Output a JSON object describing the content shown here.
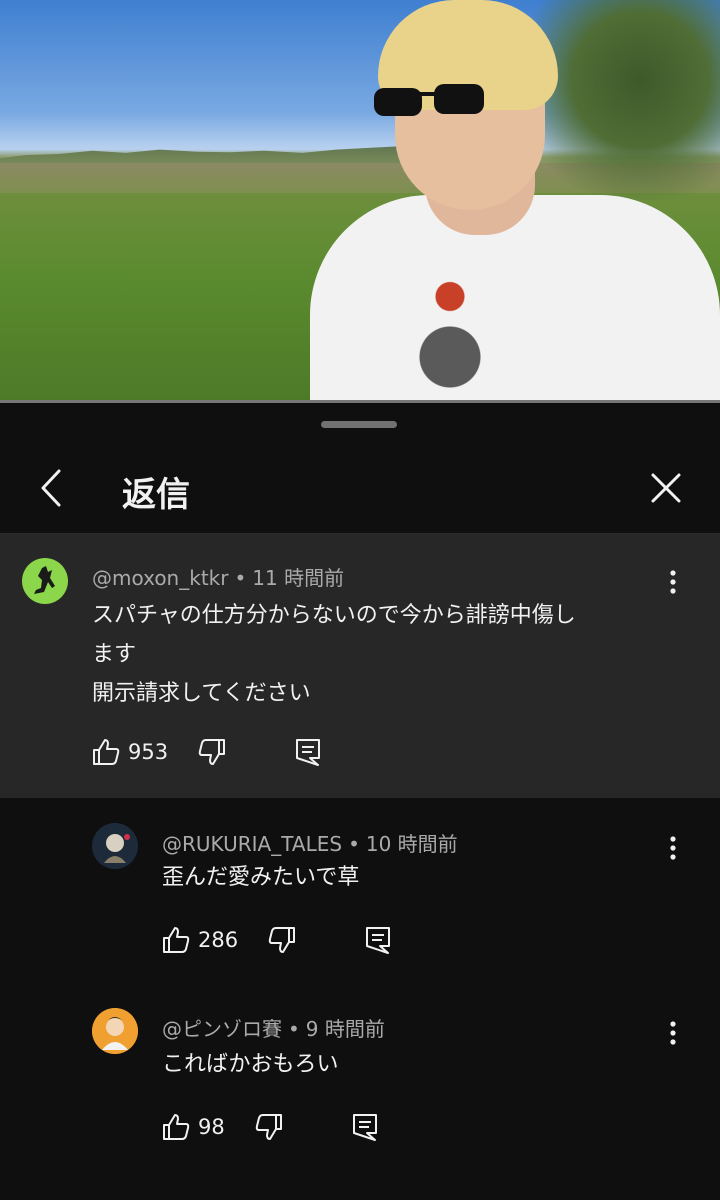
{
  "sheet": {
    "title": "返信"
  },
  "parent": {
    "author": "@moxon_ktkr",
    "separator": "•",
    "time": "11 時間前",
    "text_lines": [
      "スパチャの仕方分からないので今から誹謗中傷し",
      "ます",
      "開示請求してください"
    ],
    "likes": "953",
    "avatar_color": "#8bd64a"
  },
  "replies": [
    {
      "author": "@RUKURIA_TALES",
      "separator": "•",
      "time": "10 時間前",
      "text": "歪んだ愛みたいで草",
      "likes": "286",
      "avatar_color": "#1d2a3a"
    },
    {
      "author": "@ピンゾロ賽",
      "separator": "•",
      "time": "9 時間前",
      "text": "こればかおもろい",
      "likes": "98",
      "avatar_color": "#f0a030"
    }
  ],
  "colors": {
    "background": "#0f0f0f",
    "highlight": "#272727",
    "secondary_text": "#aaaaaa",
    "primary_text": "#f1f1f1"
  }
}
